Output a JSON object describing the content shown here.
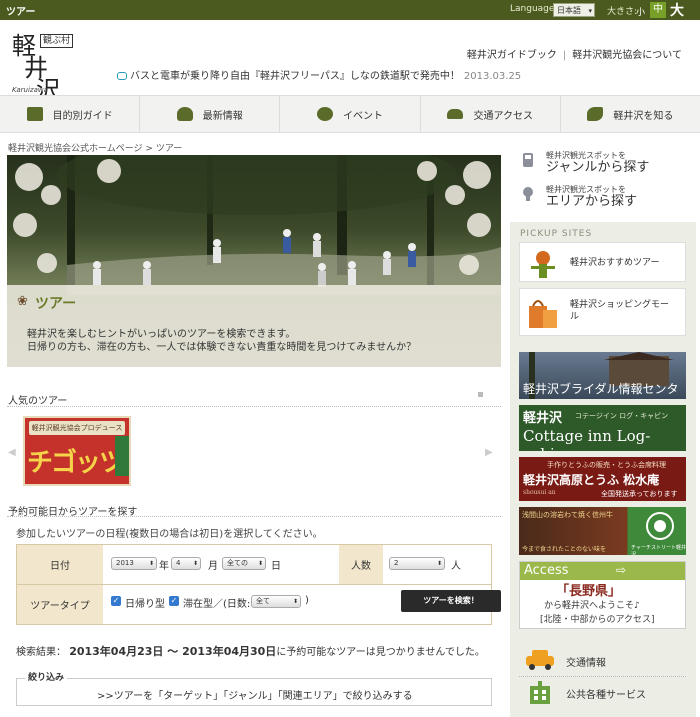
{
  "topbar": {
    "title": "ツアー",
    "language_label": "Language:",
    "language_value": "日本語",
    "size_label": "大きさ:",
    "size_small": "小",
    "size_medium": "中",
    "size_large": "大"
  },
  "logo": {
    "kanji_1": "軽",
    "kanji_2": "井",
    "kanji_3": "沢",
    "stamp": "観ぶ村",
    "romaji": "Karuizawa"
  },
  "header_links": {
    "guidebook": "軽井沢ガイドブック",
    "separator": "|",
    "about": "軽井沢観光協会について"
  },
  "news": {
    "text": "バスと電車が乗り降り自由『軽井沢フリーパス』しなの鉄道駅で発売中！",
    "date": "2013.03.25"
  },
  "nav": [
    {
      "label": "目的別ガイド",
      "icon": "camera-icon"
    },
    {
      "label": "最新情報",
      "icon": "info-icon"
    },
    {
      "label": "イベント",
      "icon": "event-icon"
    },
    {
      "label": "交通アクセス",
      "icon": "car-icon"
    },
    {
      "label": "軽井沢を知る",
      "icon": "leaf-icon"
    }
  ],
  "breadcrumb": "軽井沢観光協会公式ホームページ > ツアー",
  "hero": {
    "title": "ツアー",
    "desc_line1": "軽井沢を楽しむヒントがいっぱいのツアーを検索できます。",
    "desc_line2": "日帰りの方も、滞在の方も、一人では体験できない貴重な時間を見つけてみませんか？"
  },
  "popular": {
    "title": "人気のツアー",
    "banner_top": "軽井沢観光協会プロデュース",
    "banner_main": "チゴッツア",
    "prev": "◀",
    "next": "▶"
  },
  "search": {
    "title": "予約可能日からツアーを探す",
    "hint": "参加したいツアーの日程(複数日の場合は初日)を選択してください。",
    "date_label": "日付",
    "year_value": "2013",
    "year_unit": "年",
    "month_value": "4",
    "month_unit": "月",
    "day_value": "全ての",
    "day_unit": "日",
    "people_label": "人数",
    "people_value": "2",
    "people_unit": "人",
    "type_label": "ツアータイプ",
    "type_daytrip": "日帰り型",
    "type_stay": "滞在型／(日数:",
    "stay_days_value": "全て",
    "close_paren": ")",
    "search_button": "ツアーを検索！"
  },
  "result": {
    "prefix": "検索結果：",
    "range": "2013年04月23日 〜 2013年04月30日",
    "suffix": "に予約可能なツアーは見つかりませんでした。"
  },
  "filter": {
    "title": "絞り込み",
    "text": ">>ツアーを「ターゲット」「ジャンル」「関連エリア」で絞り込みする"
  },
  "sidebar": {
    "genre_small": "軽井沢観光スポットを",
    "genre_big": "ジャンルから探す",
    "area_small": "軽井沢観光スポットを",
    "area_big": "エリアから探す",
    "pickup_title": "PICKUP SITES",
    "card1": "軽井沢おすすめツアー",
    "card2_line1": "軽井沢ショッピングモー",
    "card2_line2": "ル",
    "banner1": "軽井沢ブライダル情報センター",
    "banner2_main": "軽井沢",
    "banner2_sub": "Cottage inn Log-cabin",
    "banner2_top": "コテージイン ログ・キャビン",
    "banner3_top": "手作りとうふの販売・とうふ会席料理",
    "banner3_main": "軽井沢高原とうふ 松水庵",
    "banner3_bottom": "全国発送承っております",
    "banner3_romaji": "shousui an",
    "banner4_top": "浅間山の溶岩わて焼く信州牛",
    "banner4_bottom": "今まで食されたことのない味を",
    "banner4_right": "チャーチストリート軽井沢",
    "banner5_access": "Access",
    "banner5_pref": "「長野県」",
    "banner5_line2": "から軽井沢へようこそ♪",
    "banner5_line3": "[北陸・中部からのアクセス]",
    "traffic": "交通情報",
    "public": "公共各種サービス"
  },
  "colors": {
    "topbar": "#4b5a1e",
    "accent_green": "#78a028",
    "tour_title": "#6b7a2a",
    "table_label_bg": "#f2e7cc"
  }
}
